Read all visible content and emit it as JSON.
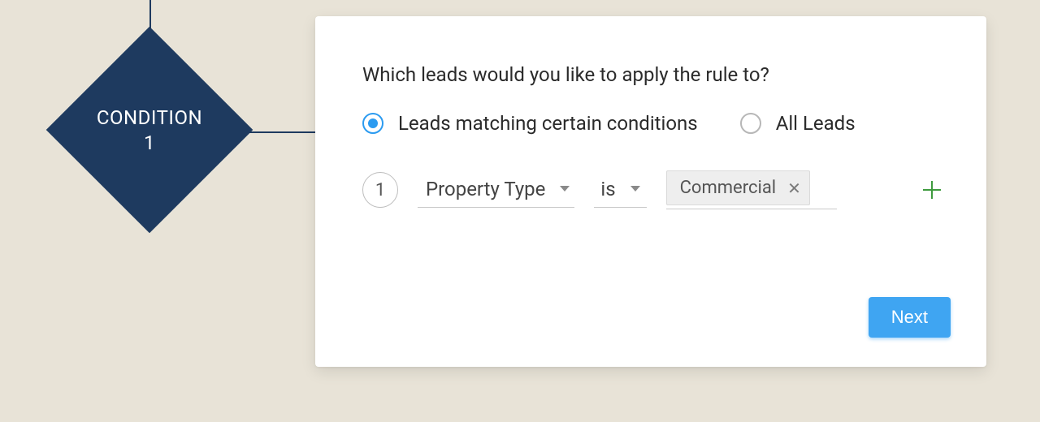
{
  "colors": {
    "brand_dark": "#1E3A5F",
    "accent": "#3FA5F2",
    "radio_selected": "#2C9BF0",
    "plus_icon": "#3F9B3F"
  },
  "flow": {
    "node_title": "CONDITION",
    "node_index": "1"
  },
  "card": {
    "title": "Which leads would you like to apply the rule to?",
    "radios": {
      "matching": {
        "label": "Leads matching certain conditions",
        "selected": true
      },
      "all": {
        "label": "All Leads",
        "selected": false
      }
    },
    "condition_rows": [
      {
        "index": "1",
        "field": "Property Type",
        "operator": "is",
        "value_chip": "Commercial"
      }
    ],
    "add_icon": "plus-icon",
    "footer": {
      "next_label": "Next"
    }
  }
}
